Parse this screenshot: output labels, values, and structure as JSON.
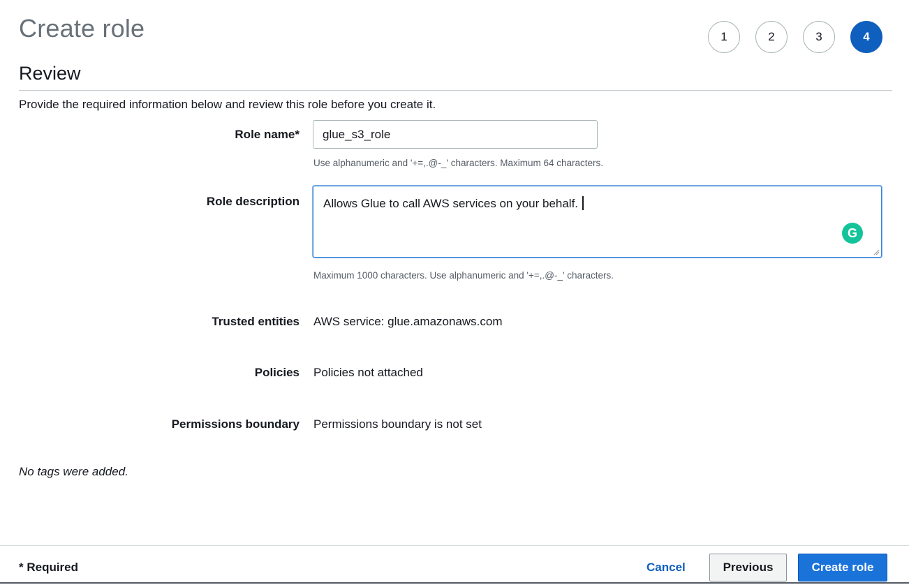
{
  "header": {
    "title": "Create role",
    "steps": [
      "1",
      "2",
      "3",
      "4"
    ],
    "active_step": "4"
  },
  "review": {
    "title": "Review",
    "intro": "Provide the required information below and review this role before you create it."
  },
  "form": {
    "role_name_label": "Role name*",
    "role_name_value": "glue_s3_role",
    "role_name_hint": "Use alphanumeric and '+=,.@-_' characters. Maximum 64 characters.",
    "role_description_label": "Role description",
    "role_description_value": "Allows Glue to call AWS services on your behalf.",
    "role_description_hint": "Maximum 1000 characters. Use alphanumeric and '+=,.@-_' characters.",
    "grammarly_glyph": "G",
    "trusted_entities_label": "Trusted entities",
    "trusted_entities_value": "AWS service: glue.amazonaws.com",
    "policies_label": "Policies",
    "policies_value": "Policies not attached",
    "permissions_boundary_label": "Permissions boundary",
    "permissions_boundary_value": "Permissions boundary is not set",
    "no_tags": "No tags were added."
  },
  "footer": {
    "required_note": "* Required",
    "cancel_label": "Cancel",
    "previous_label": "Previous",
    "create_label": "Create role"
  },
  "colors": {
    "primary": "#0f5fbf",
    "create_button": "#1a73d9",
    "grammarly": "#15c39a",
    "focus_border": "#3a87d8"
  }
}
